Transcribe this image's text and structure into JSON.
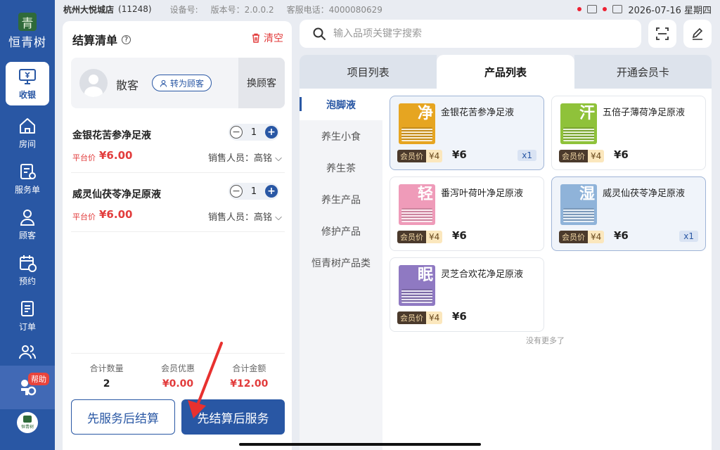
{
  "status_bar": {
    "store_name": "杭州大悦城店",
    "store_id": "(11248)",
    "device_label": "设备号:",
    "version_label": "版本号：2.0.0.2",
    "service_phone": "客服电话：4000080629",
    "date": "2026-07-16 星期四"
  },
  "sidebar": {
    "brand": "恒青树",
    "brand_mark": "青",
    "items": [
      {
        "label": "收银",
        "icon": "monitor-yen-icon"
      },
      {
        "label": "房间",
        "icon": "house-icon"
      },
      {
        "label": "服务单",
        "icon": "service-list-icon"
      },
      {
        "label": "顾客",
        "icon": "person-icon"
      },
      {
        "label": "预约",
        "icon": "calendar-clock-icon"
      },
      {
        "label": "订单",
        "icon": "document-icon"
      },
      {
        "label": "",
        "icon": "people-icon"
      }
    ],
    "help_badge": "帮助",
    "footer_brand": "恒青树"
  },
  "checkout": {
    "title": "结算清单",
    "clear_label": "清空",
    "customer_name": "散客",
    "convert_label": "转为顾客",
    "switch_label": "换顾客",
    "items": [
      {
        "name": "金银花苦参净足液",
        "qty": "1",
        "price_label": "平台价",
        "price": "¥6.00",
        "seller": "销售人员：高铭"
      },
      {
        "name": "威灵仙茯苓净足原液",
        "qty": "1",
        "price_label": "平台价",
        "price": "¥6.00",
        "seller": "销售人员：高铭"
      }
    ],
    "totals": [
      {
        "label": "合计数量",
        "value": "2"
      },
      {
        "label": "会员优惠",
        "value": "¥0.00"
      },
      {
        "label": "合计金额",
        "value": "¥12.00"
      }
    ],
    "btn_service_first": "先服务后结算",
    "btn_pay_first": "先结算后服务"
  },
  "search": {
    "placeholder": "输入品项关键字搜索"
  },
  "tabs": [
    {
      "label": "项目列表"
    },
    {
      "label": "产品列表"
    },
    {
      "label": "开通会员卡"
    }
  ],
  "categories": [
    "泡脚液",
    "养生小食",
    "养生茶",
    "养生产品",
    "修护产品",
    "恒青树产品类"
  ],
  "products": [
    {
      "name": "金银花苦参净足液",
      "glyph": "净",
      "color": "#e6a521",
      "member_label": "会员价",
      "member_price": "¥4",
      "price": "¥6",
      "qty": "x1"
    },
    {
      "name": "五倍子薄荷净足原液",
      "glyph": "汗",
      "color": "#8fc23a",
      "member_label": "会员价",
      "member_price": "¥4",
      "price": "¥6",
      "qty": ""
    },
    {
      "name": "番泻叶荷叶净足原液",
      "glyph": "轻",
      "color": "#ef9bb9",
      "member_label": "会员价",
      "member_price": "¥4",
      "price": "¥6",
      "qty": ""
    },
    {
      "name": "威灵仙茯苓净足原液",
      "glyph": "湿",
      "color": "#8fb3d9",
      "member_label": "会员价",
      "member_price": "¥4",
      "price": "¥6",
      "qty": "x1"
    },
    {
      "name": "灵芝合欢花净足原液",
      "glyph": "眠",
      "color": "#8f79c2",
      "member_label": "会员价",
      "member_price": "¥4",
      "price": "¥6",
      "qty": ""
    }
  ],
  "no_more": "没有更多了",
  "colors": {
    "primary": "#2957a4",
    "accent_red": "#e23c3c",
    "background": "#e9ecf2"
  }
}
